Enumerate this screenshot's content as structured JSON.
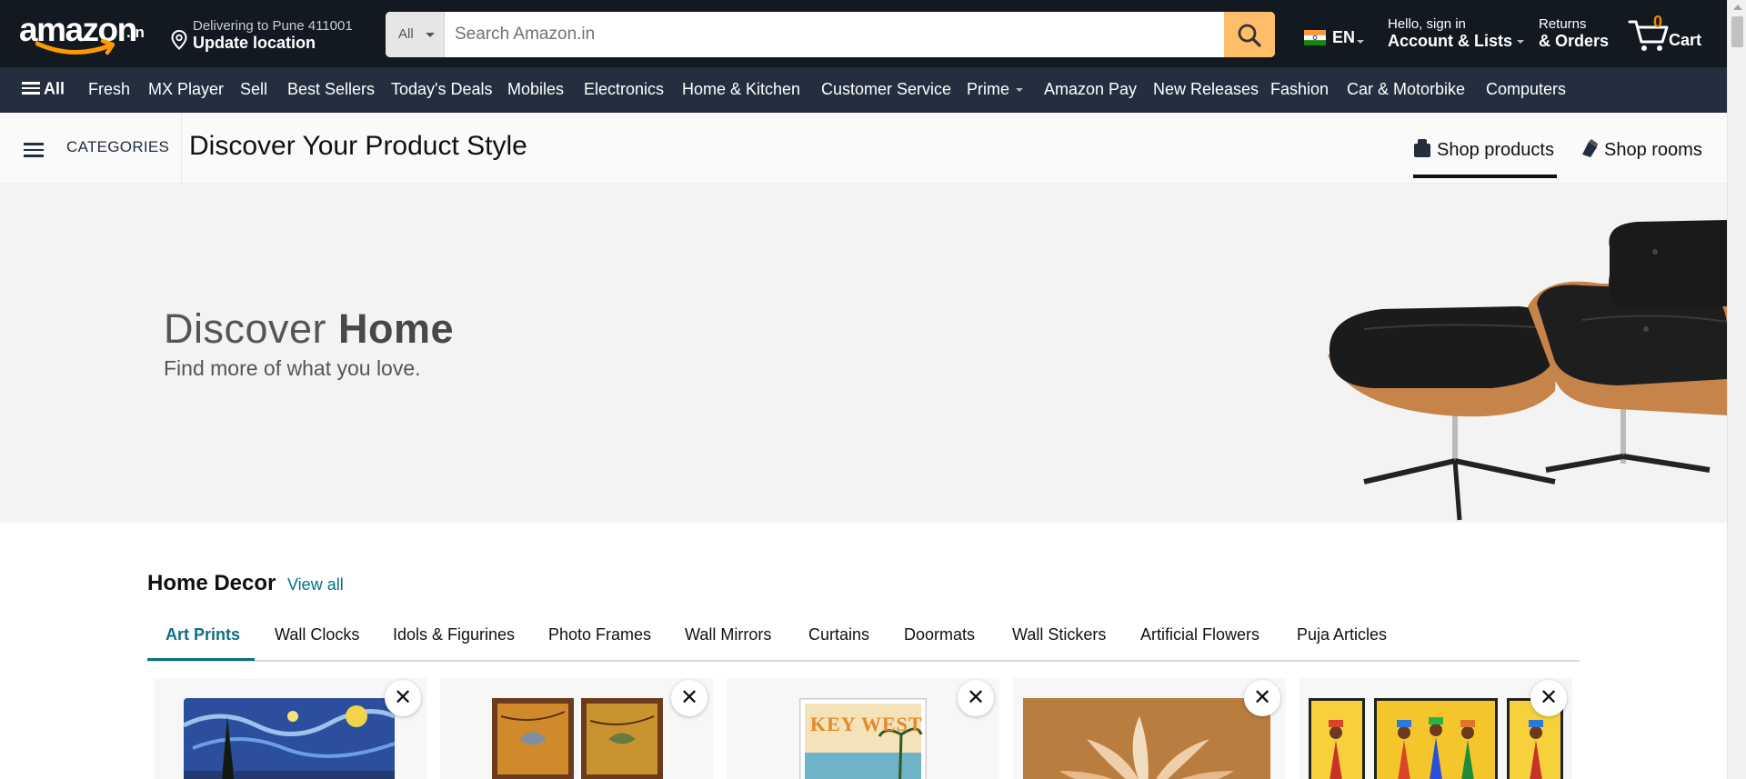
{
  "header": {
    "logo_text": "amazon",
    "logo_tld": ".in",
    "location_line1": "Delivering to Pune 411001",
    "location_line2": "Update location",
    "search_category": "All",
    "search_placeholder": "Search Amazon.in",
    "language": "EN",
    "account_line1": "Hello, sign in",
    "account_line2": "Account & Lists",
    "orders_line1": "Returns",
    "orders_line2": "& Orders",
    "cart_count": "0",
    "cart_label": "Cart"
  },
  "nav": {
    "all_label": "All",
    "links": [
      "Fresh",
      "MX Player",
      "Sell",
      "Best Sellers",
      "Today's Deals",
      "Mobiles",
      "Electronics",
      "Home & Kitchen",
      "Customer Service",
      "Prime",
      "Amazon Pay",
      "New Releases",
      "Fashion",
      "Car & Motorbike",
      "Computers"
    ]
  },
  "subheader": {
    "categories_label": "CATEGORIES",
    "title": "Discover Your Product Style",
    "shop_products": "Shop products",
    "shop_rooms": "Shop rooms"
  },
  "hero": {
    "title_light": "Discover ",
    "title_bold": "Home",
    "subtitle": "Find more of what you love."
  },
  "home_decor": {
    "title": "Home Decor",
    "view_all": "View all",
    "tabs": [
      "Art Prints",
      "Wall Clocks",
      "Idols & Figurines",
      "Photo Frames",
      "Wall Mirrors",
      "Curtains",
      "Doormats",
      "Wall Stickers",
      "Artificial Flowers",
      "Puja Articles"
    ],
    "active_tab": "Art Prints",
    "card_close_glyph": "✕",
    "keywest_text": "KEY WEST"
  },
  "colors": {
    "nav_dark": "#131921",
    "nav_secondary": "#232f3e",
    "search_button": "#febd69",
    "cart_count": "#f08804",
    "link_teal": "#007185",
    "active_tab": "#0f6e84"
  }
}
